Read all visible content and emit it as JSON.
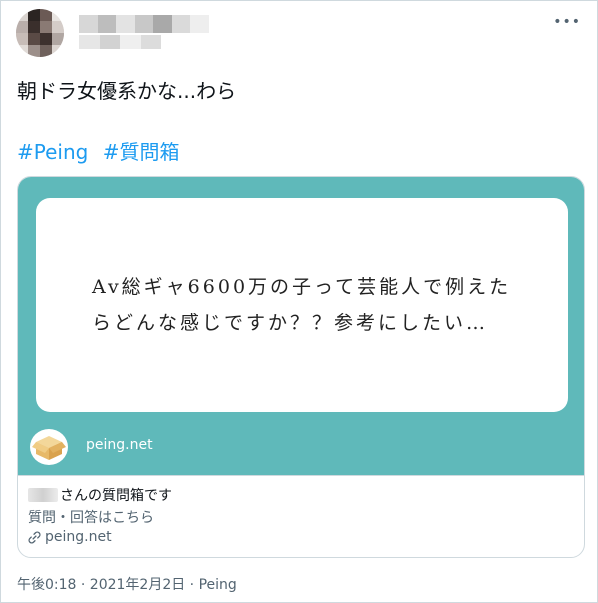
{
  "header": {
    "more_icon": "more-horizontal-icon"
  },
  "tweet": {
    "text": "朝ドラ女優系かな...わら",
    "hashtags": [
      "#Peing",
      "#質問箱"
    ]
  },
  "card": {
    "question_lines": [
      "Av総ギャ6600万の子って芸能人で例えた",
      "らどんな感じですか？？参考にしたい…"
    ],
    "logo_icon": "peing-box-icon",
    "domain_overlay": "peing.net",
    "title_suffix": "さんの質問箱です",
    "description": "質問・回答はこちら",
    "link_icon": "link-icon",
    "link_domain": "peing.net",
    "colors": {
      "image_bg": "#5fb9ba",
      "box_bg": "#ffffff"
    }
  },
  "meta": {
    "timestamp": "午後0:18 · 2021年2月2日 · Peing"
  },
  "colors": {
    "text": "#0f1419",
    "secondary": "#536471",
    "hashtag": "#1d9bf0",
    "border": "#cfd9de"
  }
}
